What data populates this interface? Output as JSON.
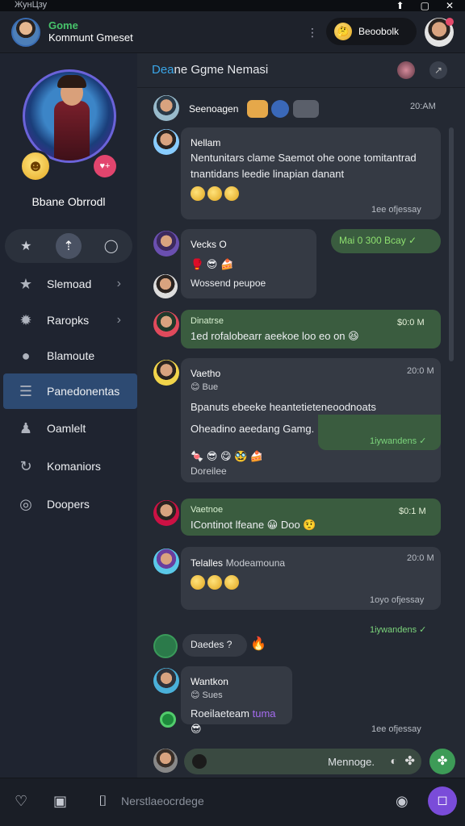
{
  "status_bar": {
    "time": "ЖунЦзу"
  },
  "header": {
    "app_name": "Gome",
    "app_subtitle": "Kommunt Gmeset",
    "pill_label": "Beoobolk",
    "pill_emoji": "🤔"
  },
  "sidebar": {
    "profile_name": "Bbane Obrrodl",
    "badge_small": "♥+",
    "items": [
      {
        "label": "Slemoad",
        "icon": "star-icon",
        "chevron": true
      },
      {
        "label": "Raropks",
        "icon": "puzzle-icon",
        "chevron": true
      },
      {
        "label": "Blamoute",
        "icon": "chat-bubble-icon",
        "chevron": false
      },
      {
        "label": "Panedonentas",
        "icon": "list-icon",
        "chevron": false,
        "active": true
      },
      {
        "label": "Oamlelt",
        "icon": "person-icon",
        "chevron": false
      },
      {
        "label": "Komaniors",
        "icon": "refresh-icon",
        "chevron": false
      },
      {
        "label": "Doopers",
        "icon": "circle-icon",
        "chevron": false
      }
    ]
  },
  "chat": {
    "title_highlight": "Dea",
    "title_rest": "ne Ggme Nemasi",
    "messages": [
      {
        "sender": "Seenoagen",
        "time": "20:AM"
      },
      {
        "sender": "Nellam",
        "text1": "Nentunitars clame Saemot ohe oone tomitantrad",
        "text2": "tnantidans leedie linapian danant",
        "status": "1ee ofjessay"
      },
      {
        "sender": "Vecks O",
        "chip": "Mai 0 300 Bcay ✓"
      },
      {
        "sender": "Wossend peupoe"
      },
      {
        "sender": "Dinatrse",
        "text": "1ed rofalobearr aeekoe loo eo on 😆",
        "time": "$0:0 M"
      },
      {
        "sender": "Vaetho",
        "sub": "😊 Bue",
        "time": "20:0 M",
        "text1": "Bpanuts ebeeke heantetieteneoodnoats",
        "text2": "Oheadino aeedang Gamg.",
        "status": "1iywandens ✓",
        "footer": "Doreilee"
      },
      {
        "sender": "Vaetnoe",
        "text": "IContinot lfeane 😀 Doo 🤨",
        "time": "$0:1 M"
      },
      {
        "sender": "Telalles",
        "sub_inline": "Modeamouna",
        "time": "20:0 M",
        "status": "1oyo ofjessay"
      },
      {
        "status_alone": "1iywandens ✓"
      },
      {
        "sender": "Daedes ?"
      },
      {
        "sender": "Wantkon",
        "sub": "😊 Sues",
        "text": "Roeilaeteam",
        "text_purple": "tuma",
        "status": "1ee ofjessay"
      }
    ]
  },
  "composer": {
    "placeholder": "Mennoge."
  },
  "bottom_bar": {
    "text": "Nerstlaeocrdege"
  }
}
